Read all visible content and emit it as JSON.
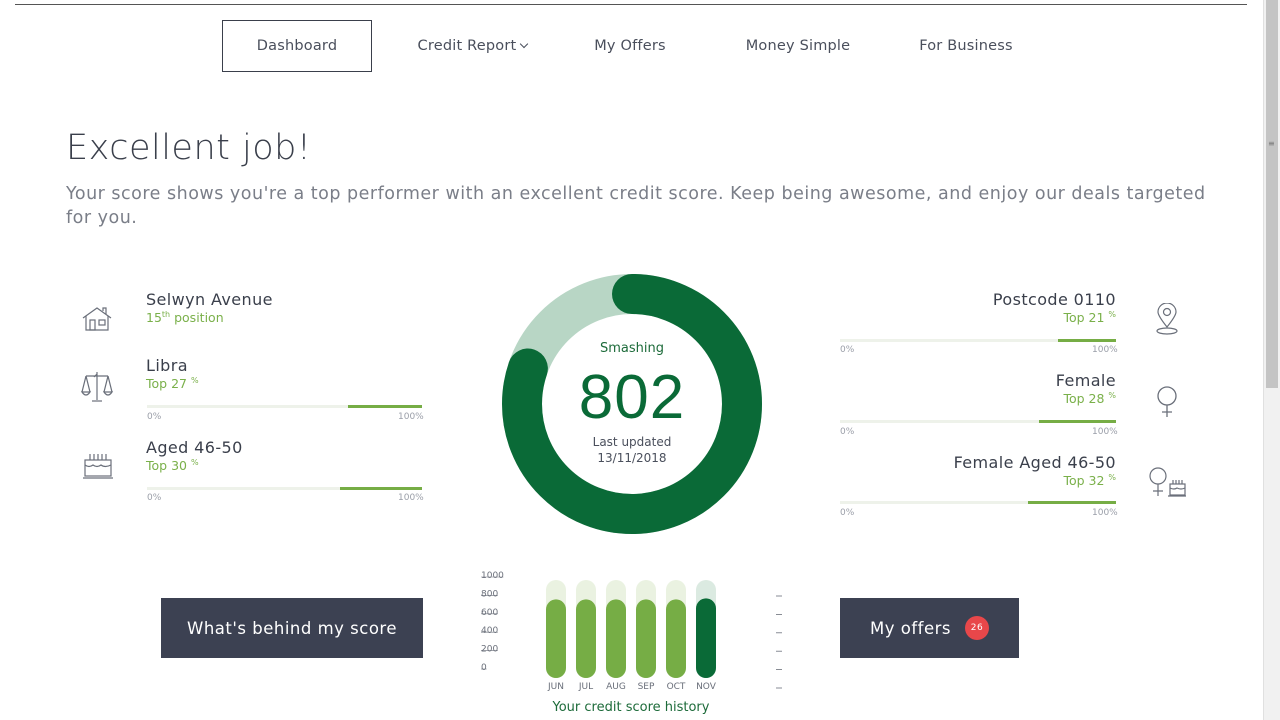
{
  "nav": {
    "items": [
      {
        "label": "Dashboard",
        "active": true
      },
      {
        "label": "Credit Report",
        "dropdown": true
      },
      {
        "label": "My Offers"
      },
      {
        "label": "Money Simple"
      },
      {
        "label": "For Business"
      }
    ]
  },
  "headline": "Excellent job!",
  "subtext": "Your score shows you're a top performer with an excellent credit score. Keep being awesome, and enjoy our deals targeted for you.",
  "left_stats": [
    {
      "title": "Selwyn Avenue",
      "sub_prefix": "15",
      "sub_sup": "th",
      "sub_suffix": " position",
      "icon": "house-icon"
    },
    {
      "title": "Libra",
      "sub_prefix": "Top 27 ",
      "sub_sup": "%",
      "percent": 27,
      "bar_min": "0%",
      "bar_max": "100%",
      "icon": "libra-scales-icon"
    },
    {
      "title": "Aged 46-50",
      "sub_prefix": "Top 30 ",
      "sub_sup": "%",
      "percent": 30,
      "bar_min": "0%",
      "bar_max": "100%",
      "icon": "birthday-cake-icon"
    }
  ],
  "right_stats": [
    {
      "title": "Postcode 0110",
      "sub_prefix": "Top 21 ",
      "sub_sup": "%",
      "percent": 21,
      "bar_min": "0%",
      "bar_max": "100%",
      "icon": "location-pin-icon"
    },
    {
      "title": "Female",
      "sub_prefix": "Top 28 ",
      "sub_sup": "%",
      "percent": 28,
      "bar_min": "0%",
      "bar_max": "100%",
      "icon": "female-icon"
    },
    {
      "title": "Female Aged 46-50",
      "sub_prefix": "Top 32 ",
      "sub_sup": "%",
      "percent": 32,
      "bar_min": "0%",
      "bar_max": "100%",
      "icon": "female-cake-icon"
    }
  ],
  "gauge": {
    "status": "Smashing",
    "score": "802",
    "score_value": 802,
    "score_max": 1000,
    "updated_label": "Last updated",
    "updated_date": "13/11/2018"
  },
  "buttons": {
    "behind_score": "What's behind my score",
    "my_offers": "My offers",
    "offers_count": "26"
  },
  "chart_data": {
    "type": "bar",
    "categories": [
      "JUN",
      "JUL",
      "AUG",
      "SEP",
      "OCT",
      "NOV"
    ],
    "values": [
      802,
      802,
      802,
      802,
      802,
      812
    ],
    "ylim": [
      0,
      1000
    ],
    "yticks": [
      "1000",
      "800",
      "600",
      "400",
      "200",
      "0"
    ],
    "title": "Your credit score history",
    "highlight_last": true
  },
  "colors": {
    "dark_green": "#0a6a37",
    "light_green": "#76ad45",
    "pale_green": "#b8d6c5",
    "button_bg": "#3c4152",
    "badge": "#e8474a"
  }
}
